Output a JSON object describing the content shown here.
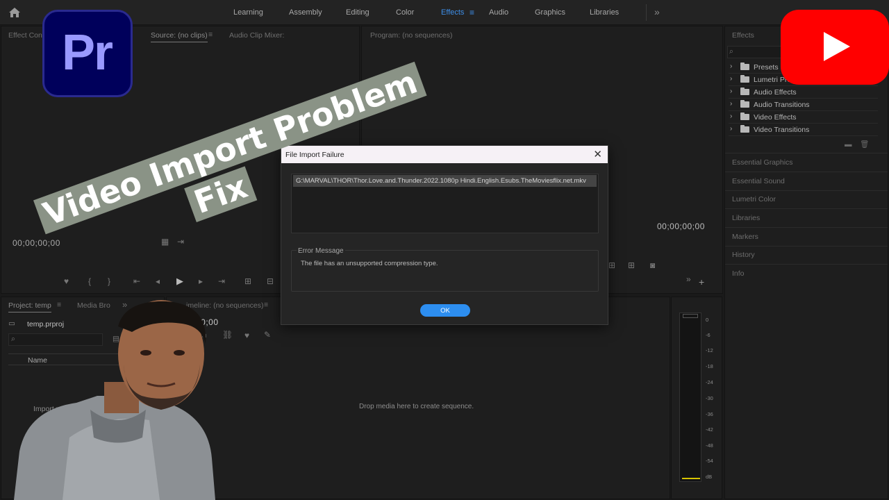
{
  "workspaces": {
    "tabs": [
      "Learning",
      "Assembly",
      "Editing",
      "Color",
      "Effects",
      "Audio",
      "Graphics",
      "Libraries"
    ],
    "active": "Effects"
  },
  "source_panel": {
    "effect_controls_title": "Effect Contr",
    "source_title": "Source: (no clips)",
    "audio_mixer_title": "Audio Clip Mixer:",
    "timecode": "00;00;00;00"
  },
  "program_panel": {
    "title": "Program: (no sequences)",
    "timecode": "00;00;00;00"
  },
  "project_panel": {
    "title": "Project: temp",
    "media_browser": "Media Bro",
    "file": "temp.prproj",
    "column_name": "Name",
    "import_hint": "Import me"
  },
  "timeline_panel": {
    "title": "imeline: (no sequences)",
    "timecode": "00;00",
    "drop_hint": "Drop media here to create sequence."
  },
  "effects_panel": {
    "title": "Effects",
    "items": [
      "Presets",
      "Lumetri Pre",
      "Audio Effects",
      "Audio Transitions",
      "Video Effects",
      "Video Transitions"
    ],
    "sections": [
      "Essential Graphics",
      "Essential Sound",
      "Lumetri Color",
      "Libraries",
      "Markers",
      "History",
      "Info"
    ]
  },
  "audio_meter": {
    "labels": [
      "0",
      "-6",
      "-12",
      "-18",
      "-24",
      "-30",
      "-36",
      "-42",
      "-48",
      "-54",
      "dB"
    ]
  },
  "dialog": {
    "title": "File Import Failure",
    "file_path": "G:\\MARVAL\\THOR\\Thor.Love.and.Thunder.2022.1080p Hindi.English.Esubs.TheMoviesflix.net.mkv",
    "error_legend": "Error Message",
    "error_text": "The file has an unsupported compression type.",
    "ok_label": "OK"
  },
  "overlay": {
    "premiere_logo_text": "Pr",
    "title_line1": "Video Import Problem",
    "title_line2": "Fix"
  },
  "colors": {
    "accent": "#3d8ee8",
    "ok_button": "#2d8ef0",
    "youtube_red": "#ff0000",
    "premiere_bg": "#00005b",
    "premiere_text": "#9999ff"
  }
}
